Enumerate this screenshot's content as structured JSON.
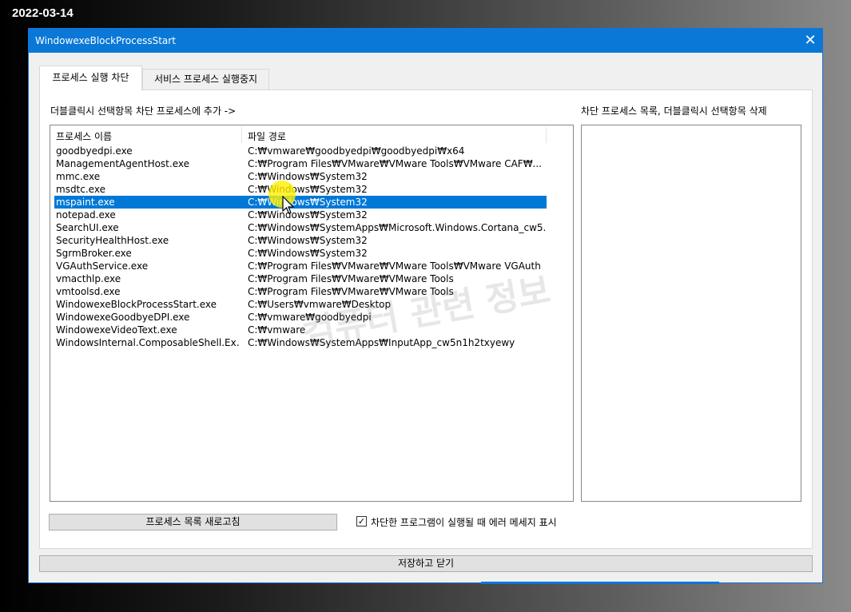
{
  "date_stamp": "2022-03-14",
  "window": {
    "title": "WindowexeBlockProcessStart",
    "close_glyph": "✕"
  },
  "tabs": [
    {
      "label": "프로세스 실행 차단",
      "active": true
    },
    {
      "label": "서비스 프로세스 실행중지",
      "active": false
    }
  ],
  "left_hint": "더블클릭시 선택항목 차단 프로세스에 추가 ->",
  "right_hint": "차단 프로세스 목록, 더블클릭시 선택항목 삭제",
  "process_list": {
    "columns": [
      "프로세스 이름",
      "파일 경로"
    ],
    "selected_index": 4,
    "rows": [
      [
        "goodbyedpi.exe",
        "C:₩vmware₩goodbyedpi₩goodbyedpi₩x64"
      ],
      [
        "ManagementAgentHost.exe",
        "C:₩Program Files₩VMware₩VMware Tools₩VMware CAF₩..."
      ],
      [
        "mmc.exe",
        "C:₩Windows₩System32"
      ],
      [
        "msdtc.exe",
        "C:₩Windows₩System32"
      ],
      [
        "mspaint.exe",
        "C:₩Windows₩System32"
      ],
      [
        "notepad.exe",
        "C:₩Windows₩System32"
      ],
      [
        "SearchUI.exe",
        "C:₩Windows₩SystemApps₩Microsoft.Windows.Cortana_cw5..."
      ],
      [
        "SecurityHealthHost.exe",
        "C:₩Windows₩System32"
      ],
      [
        "SgrmBroker.exe",
        "C:₩Windows₩System32"
      ],
      [
        "VGAuthService.exe",
        "C:₩Program Files₩VMware₩VMware Tools₩VMware VGAuth"
      ],
      [
        "vmacthlp.exe",
        "C:₩Program Files₩VMware₩VMware Tools"
      ],
      [
        "vmtoolsd.exe",
        "C:₩Program Files₩VMware₩VMware Tools"
      ],
      [
        "WindowexeBlockProcessStart.exe",
        "C:₩Users₩vmware₩Desktop"
      ],
      [
        "WindowexeGoodbyeDPI.exe",
        "C:₩vmware₩goodbyedpi"
      ],
      [
        "WindowexeVideoText.exe",
        "C:₩vmware"
      ],
      [
        "WindowsInternal.ComposableShell.Ex...",
        "C:₩Windows₩SystemApps₩InputApp_cw5n1h2txyewy"
      ]
    ]
  },
  "blocked_list": {
    "rows": []
  },
  "refresh_button": "프로세스 목록 새로고침",
  "error_checkbox": {
    "label": "차단한 프로그램이 실행될 때 에러 메세지 표시",
    "checked": true,
    "glyph": "✓"
  },
  "save_button": "저장하고 닫기",
  "watermark": "컴퓨터 관련 정보",
  "colors": {
    "title_bar": "#0a78d7",
    "selection": "#0078d7",
    "cursor_halo": "#fff000"
  }
}
